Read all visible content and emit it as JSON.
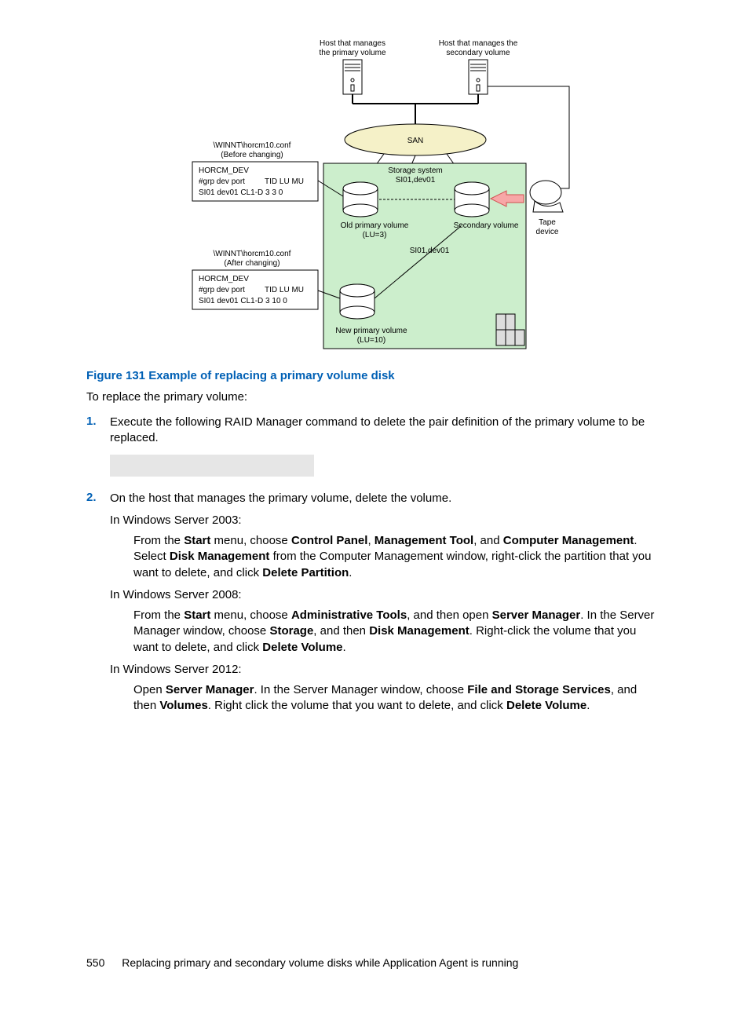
{
  "diagram": {
    "host_primary_label_l1": "Host that manages",
    "host_primary_label_l2": "the primary volume",
    "host_secondary_label_l1": "Host that manages the",
    "host_secondary_label_l2": "secondary volume",
    "san_label": "SAN",
    "conf_before_l1": "\\WINNT\\horcm10.conf",
    "conf_before_l2": "(Before changing)",
    "horcm_dev": "HORCM_DEV",
    "grp_dev_port": "#grp dev port",
    "grp_headers": "TID LU  MU",
    "grp_row1": "SI01 dev01 CL1-D 3      3    0",
    "conf_after_l1": "\\WINNT\\horcm10.conf",
    "conf_after_l2": "(After changing)",
    "grp_row2": "SI01 dev01 CL1-D 3     10   0",
    "storage_system": "Storage system",
    "si01_dev01": "SI01,dev01",
    "old_primary_l1": "Old primary volume",
    "old_primary_l2": "(LU=3)",
    "secondary_vol": "Secondary volume",
    "tape_l1": "Tape",
    "tape_l2": "device",
    "si01_dev01_2": "SI01,dev01",
    "new_primary_l1": "New primary volume",
    "new_primary_l2": "(LU=10)"
  },
  "figure_caption": "Figure 131 Example of replacing a primary volume disk",
  "intro_text": "To replace the primary volume:",
  "steps": {
    "1": "Execute the following RAID Manager command to delete the pair definition of the primary volume to be replaced.",
    "2": {
      "lead": "On the host that manages the primary volume, delete the volume.",
      "ws2003_h": "In Windows Server 2003:",
      "ws2003_t1": "From the ",
      "ws2003_b1": "Start",
      "ws2003_t2": " menu, choose ",
      "ws2003_b2": "Control Panel",
      "ws2003_t3": ", ",
      "ws2003_b3": "Management Tool",
      "ws2003_t4": ", and ",
      "ws2003_b4": "Computer Management",
      "ws2003_t5": ". Select ",
      "ws2003_b5": "Disk Management",
      "ws2003_t6": " from the Computer Management window, right-click the partition that you want to delete, and click ",
      "ws2003_b6": "Delete Partition",
      "ws2003_t7": ".",
      "ws2008_h": "In Windows Server 2008:",
      "ws2008_t1": "From the ",
      "ws2008_b1": "Start",
      "ws2008_t2": " menu, choose ",
      "ws2008_b2": "Administrative Tools",
      "ws2008_t3": ", and then open ",
      "ws2008_b3": "Server Manager",
      "ws2008_t4": ". In the Server Manager window, choose ",
      "ws2008_b4": "Storage",
      "ws2008_t5": ", and then ",
      "ws2008_b5": "Disk Management",
      "ws2008_t6": ". Right-click the volume that you want to delete, and click ",
      "ws2008_b6": "Delete Volume",
      "ws2008_t7": ".",
      "ws2012_h": "In Windows Server 2012:",
      "ws2012_t1": "Open ",
      "ws2012_b1": "Server Manager",
      "ws2012_t2": ". In the Server Manager window, choose ",
      "ws2012_b2": "File and Storage Services",
      "ws2012_t3": ", and then ",
      "ws2012_b3": "Volumes",
      "ws2012_t4": ". Right click the volume that you want to delete, and click ",
      "ws2012_b4": "Delete Volume",
      "ws2012_t5": "."
    }
  },
  "footer": {
    "page_number": "550",
    "section_title": "Replacing primary and secondary volume disks while Application Agent is running"
  }
}
